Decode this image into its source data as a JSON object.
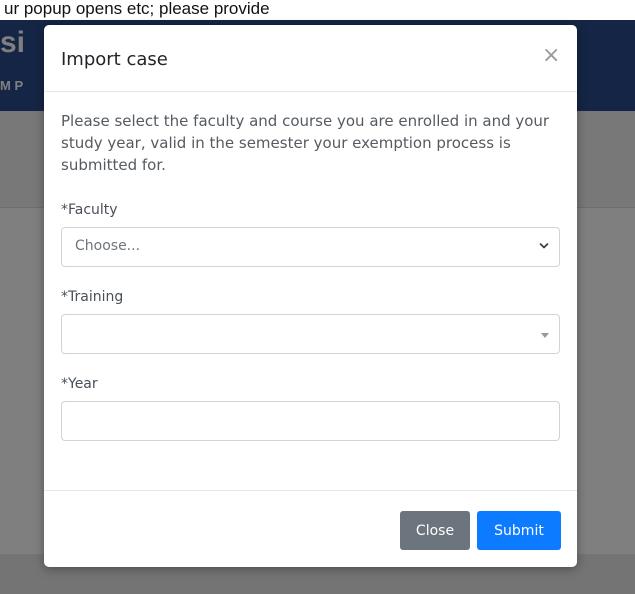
{
  "background": {
    "top_text": "ur popup opens etc; please provide"
  },
  "modal": {
    "title": "Import case",
    "close_icon": "×",
    "intro": "Please select the faculty and course you are enrolled in and your study year, valid in the semester your exemption process is submitted for.",
    "faculty_label": "*Faculty",
    "faculty_value": "Choose...",
    "training_label": "*Training",
    "training_value": "",
    "year_label": "*Year",
    "year_value": "",
    "close_button": "Close",
    "submit_button": "Submit"
  },
  "colors": {
    "header_blue": "#2a4a8a",
    "submit_blue": "#0d7bff",
    "close_gray": "#6c757d"
  }
}
